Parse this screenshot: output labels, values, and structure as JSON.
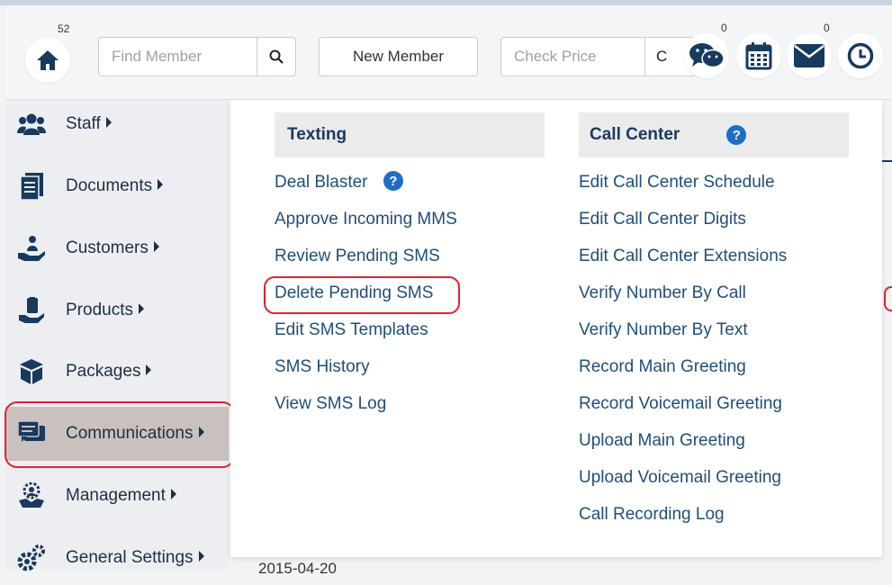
{
  "topbar": {
    "home_badge": "52",
    "find_member_placeholder": "Find Member",
    "new_member_label": "New Member",
    "check_price_placeholder": "Check Price",
    "check_price_button_partial": "C",
    "chat_badge": "0",
    "mail_badge": "0"
  },
  "sidebar": {
    "items": [
      {
        "label": "Staff",
        "icon": "users-icon"
      },
      {
        "label": "Documents",
        "icon": "document-icon"
      },
      {
        "label": "Customers",
        "icon": "customer-hand-icon"
      },
      {
        "label": "Products",
        "icon": "product-hand-icon"
      },
      {
        "label": "Packages",
        "icon": "package-icon"
      },
      {
        "label": "Communications",
        "icon": "chat-icon"
      },
      {
        "label": "Management",
        "icon": "handshake-icon"
      },
      {
        "label": "General Settings",
        "icon": "gears-icon"
      }
    ],
    "active_item": "Communications"
  },
  "dropdown": {
    "texting": {
      "header": "Texting",
      "items": [
        "Deal Blaster",
        "Approve Incoming MMS",
        "Review Pending SMS",
        "Delete Pending SMS",
        "Edit SMS Templates",
        "SMS History",
        "View SMS Log"
      ],
      "highlighted_item": "Delete Pending SMS"
    },
    "call_center": {
      "header": "Call Center",
      "items": [
        "Edit Call Center Schedule",
        "Edit Call Center Digits",
        "Edit Call Center Extensions",
        "Verify Number By Call",
        "Verify Number By Text",
        "Record Main Greeting",
        "Record Voicemail Greeting",
        "Upload Main Greeting",
        "Upload Voicemail Greeting",
        "Call Recording Log"
      ]
    },
    "help_glyph": "?"
  },
  "background": {
    "partial_date": "2015-04-20"
  },
  "colors": {
    "accent_red": "#e0232c",
    "help_blue": "#1d6ec7",
    "link_blue": "#1f4e7a",
    "icon_navy": "#173a5e"
  }
}
